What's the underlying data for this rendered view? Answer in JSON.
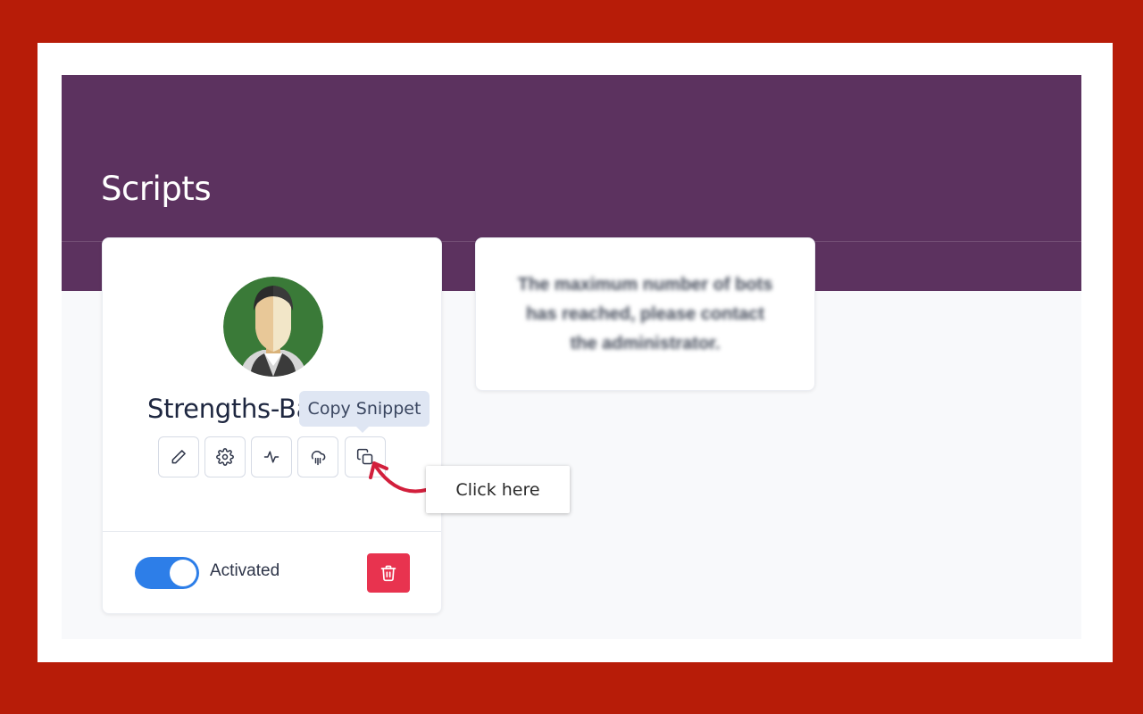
{
  "page": {
    "title": "Scripts"
  },
  "script_card": {
    "name": "Strengths-Ba",
    "tooltip": "Copy Snippet",
    "actions": [
      {
        "icon": "pencil-icon",
        "name": "edit"
      },
      {
        "icon": "gear-icon",
        "name": "settings"
      },
      {
        "icon": "activity-icon",
        "name": "activity"
      },
      {
        "icon": "cloud-rain-icon",
        "name": "deploy"
      },
      {
        "icon": "copy-icon",
        "name": "copy-snippet"
      }
    ],
    "toggle": {
      "state": "on",
      "label": "Activated"
    },
    "delete_icon": "trash-icon"
  },
  "notice": {
    "text": "The maximum number of bots has reached, please contact the administrator."
  },
  "callout": {
    "text": "Click here"
  },
  "colors": {
    "outer_border": "#b71c08",
    "header": "#5c325f",
    "toggle_on": "#2d7ee8",
    "delete": "#e8334f",
    "arrow": "#d21f3c"
  }
}
